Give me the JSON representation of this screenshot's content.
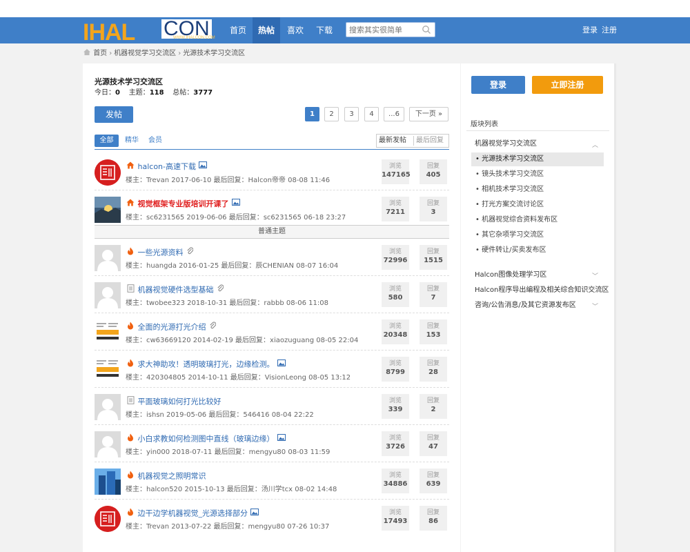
{
  "brand": {
    "left": "IHAL",
    "right": "CON",
    "url": "WWW.IHALCON.COM"
  },
  "nav": {
    "items": [
      "首页",
      "热帖",
      "喜欢",
      "下载"
    ]
  },
  "search": {
    "placeholder": "搜索其实很简单"
  },
  "auth": {
    "login": "登录",
    "register": "注册"
  },
  "breadcrumb": [
    "首页",
    "机器视觉学习交流区",
    "光源技术学习交流区"
  ],
  "forum": {
    "title": "光源技术学习交流区",
    "today_label": "今日：",
    "today": "0",
    "topics_label": "主题：",
    "topics": "118",
    "posts_label": "总帖：",
    "posts": "3777"
  },
  "toolbar": {
    "post_label": "发帖"
  },
  "pager": [
    "1",
    "2",
    "3",
    "4",
    "...6",
    "下一页 »"
  ],
  "filters": {
    "all": "全部",
    "digest": "精华",
    "member": "会员",
    "sort_new": "最新发帖",
    "sort_reply": "最后回复"
  },
  "sticky_divider": "普通主题",
  "threads": [
    {
      "title": "halcon-高速下载",
      "icon": "home-icon",
      "red": false,
      "attach": "image-icon",
      "meta": "楼主：Trevan 2017-06-10    最后回复：Halcon帝帝 08-08 11:46",
      "views": "147165",
      "replies": "405",
      "avatar": "seal"
    },
    {
      "title": "视觉框架专业版培训开课了",
      "icon": "home-icon",
      "red": true,
      "attach": "image-icon",
      "meta": "楼主：sc6231565 2019-06-06    最后回复：sc6231565 06-18 23:27",
      "views": "7211",
      "replies": "3",
      "avatar": "photo"
    },
    {
      "title": "一些光源资料",
      "icon": "flame-icon",
      "red": false,
      "attach": "clip-icon",
      "meta": "楼主：huangda 2016-01-25    最后回复：辰CHENIAN 08-07 16:04",
      "views": "72996",
      "replies": "1515",
      "avatar": "blank"
    },
    {
      "title": "机器视觉硬件选型基础",
      "icon": "doc-icon",
      "red": false,
      "attach": "clip-icon",
      "meta": "楼主：twobee323 2018-10-31    最后回复：rabbb 08-06 11:08",
      "views": "580",
      "replies": "7",
      "avatar": "blank"
    },
    {
      "title": "全面的光源打光介绍",
      "icon": "flame-icon",
      "red": false,
      "attach": "clip-icon",
      "meta": "楼主：cw63669120 2014-02-19    最后回复：xiaozuguang 08-05 22:04",
      "views": "20348",
      "replies": "153",
      "avatar": "halcon"
    },
    {
      "title": "求大神助攻！透明玻璃打光，边缘检测。",
      "icon": "flame-icon",
      "red": false,
      "attach": "image-icon",
      "meta": "楼主：420304805 2014-10-11    最后回复：VisionLeong 08-05 13:12",
      "views": "8799",
      "replies": "28",
      "avatar": "halcon"
    },
    {
      "title": "平面玻璃如何打光比较好",
      "icon": "doc-icon",
      "red": false,
      "attach": "",
      "meta": "楼主：ishsn 2019-05-06    最后回复：546416 08-04 22:22",
      "views": "339",
      "replies": "2",
      "avatar": "blank"
    },
    {
      "title": "小白求教如何检测图中直线（玻璃边缘）",
      "icon": "flame-icon",
      "red": false,
      "attach": "image-icon",
      "meta": "楼主：yin000 2018-07-11    最后回复：mengyu80 08-03 11:59",
      "views": "3726",
      "replies": "47",
      "avatar": "blank"
    },
    {
      "title": "机器视觉之照明常识",
      "icon": "flame-icon",
      "red": false,
      "attach": "",
      "meta": "楼主：halcon520 2015-10-13    最后回复：汤川学tcx 08-02 14:48",
      "views": "34886",
      "replies": "639",
      "avatar": "building"
    },
    {
      "title": "边干边学机器视觉_光源选择部分",
      "icon": "flame-icon",
      "red": false,
      "attach": "image-icon",
      "meta": "楼主：Trevan 2013-07-22    最后回复：mengyu80 07-26 10:37",
      "views": "17493",
      "replies": "86",
      "avatar": "seal"
    }
  ],
  "stat_labels": {
    "views": "浏览",
    "replies": "回复"
  },
  "sidebar": {
    "login": "登录",
    "register": "立即注册",
    "heading": "版块列表",
    "cat1": "机器视觉学习交流区",
    "subs": [
      "光源技术学习交流区",
      "镜头技术学习交流区",
      "相机技术学习交流区",
      "打光方案交流讨论区",
      "机器视觉综合资料发布区",
      "其它杂项学习交流区",
      "硬件转让/买卖发布区"
    ],
    "cat2": "Halcon图像处理学习区",
    "cat3": "Halcon程序导出编程及相关综合知识交流区",
    "cat4": "咨询/公告消息/及其它资源发布区"
  },
  "colors": {
    "primary": "#3f7fc8",
    "accent": "#f29b0d",
    "danger": "#e02020"
  }
}
